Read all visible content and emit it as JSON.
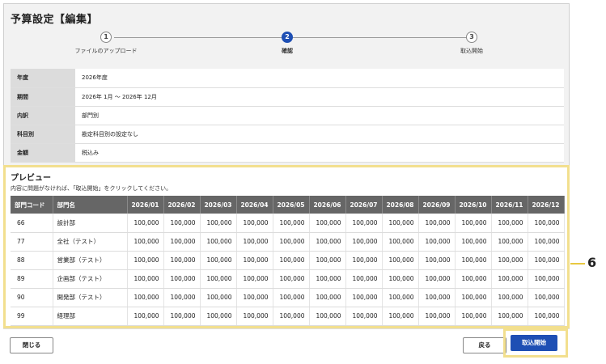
{
  "dialog": {
    "title": "予算設定【編集】"
  },
  "stepper": {
    "steps": [
      {
        "number": "1",
        "label": "ファイルのアップロード"
      },
      {
        "number": "2",
        "label": "確認"
      },
      {
        "number": "3",
        "label": "取込開始"
      }
    ],
    "active_index": 1
  },
  "info": {
    "rows": [
      {
        "key": "年度",
        "value": "2026年度"
      },
      {
        "key": "期間",
        "value": "2026年 1月 ～ 2026年 12月"
      },
      {
        "key": "内訳",
        "value": "部門別"
      },
      {
        "key": "科目別",
        "value": "勘定科目別の設定なし"
      },
      {
        "key": "金額",
        "value": "税込み"
      }
    ]
  },
  "preview": {
    "title": "プレビュー",
    "description": "内容に問題がなければ、「取込開始」をクリックしてください。",
    "columns": [
      "部門コード",
      "部門名",
      "2026/01",
      "2026/02",
      "2026/03",
      "2026/04",
      "2026/05",
      "2026/06",
      "2026/07",
      "2026/08",
      "2026/09",
      "2026/10",
      "2026/11",
      "2026/12"
    ],
    "rows": [
      {
        "code": "66",
        "name": "設計部",
        "values": [
          "100,000",
          "100,000",
          "100,000",
          "100,000",
          "100,000",
          "100,000",
          "100,000",
          "100,000",
          "100,000",
          "100,000",
          "100,000",
          "100,000"
        ]
      },
      {
        "code": "77",
        "name": "全社（テスト）",
        "values": [
          "100,000",
          "100,000",
          "100,000",
          "100,000",
          "100,000",
          "100,000",
          "100,000",
          "100,000",
          "100,000",
          "100,000",
          "100,000",
          "100,000"
        ]
      },
      {
        "code": "88",
        "name": "営業部（テスト）",
        "values": [
          "100,000",
          "100,000",
          "100,000",
          "100,000",
          "100,000",
          "100,000",
          "100,000",
          "100,000",
          "100,000",
          "100,000",
          "100,000",
          "100,000"
        ]
      },
      {
        "code": "89",
        "name": "企画部（テスト）",
        "values": [
          "100,000",
          "100,000",
          "100,000",
          "100,000",
          "100,000",
          "100,000",
          "100,000",
          "100,000",
          "100,000",
          "100,000",
          "100,000",
          "100,000"
        ]
      },
      {
        "code": "90",
        "name": "開発部（テスト）",
        "values": [
          "100,000",
          "100,000",
          "100,000",
          "100,000",
          "100,000",
          "100,000",
          "100,000",
          "100,000",
          "100,000",
          "100,000",
          "100,000",
          "100,000"
        ]
      },
      {
        "code": "99",
        "name": "経理部",
        "values": [
          "100,000",
          "100,000",
          "100,000",
          "100,000",
          "100,000",
          "100,000",
          "100,000",
          "100,000",
          "100,000",
          "100,000",
          "100,000",
          "100,000"
        ]
      }
    ]
  },
  "footer": {
    "close_label": "閉じる",
    "back_label": "戻る",
    "start_label": "取込開始"
  },
  "annotation": {
    "number": "6",
    "highlight_color": "#f2df8e"
  },
  "colors": {
    "accent": "#1e4fb4",
    "header_bg": "#666666"
  }
}
